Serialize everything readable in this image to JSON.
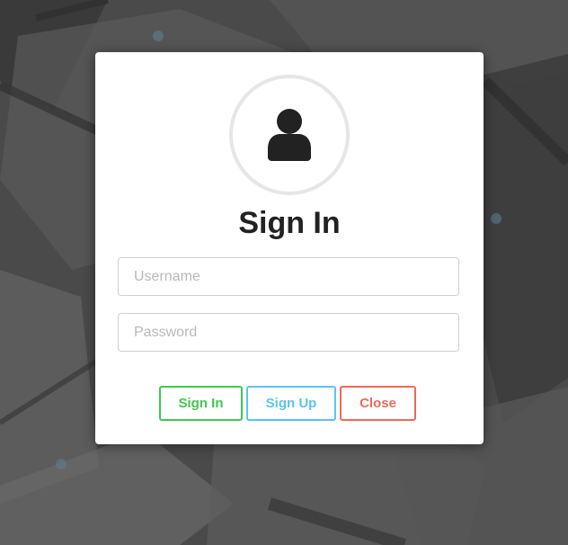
{
  "dialog": {
    "title": "Sign In",
    "avatar_icon": "user-icon"
  },
  "form": {
    "username": {
      "placeholder": "Username",
      "value": ""
    },
    "password": {
      "placeholder": "Password",
      "value": ""
    }
  },
  "buttons": {
    "sign_in": "Sign In",
    "sign_up": "Sign Up",
    "close": "Close"
  },
  "colors": {
    "sign_in": "#3fc84f",
    "sign_up": "#5bc4ee",
    "close": "#ee6a5b",
    "title": "#222222"
  }
}
